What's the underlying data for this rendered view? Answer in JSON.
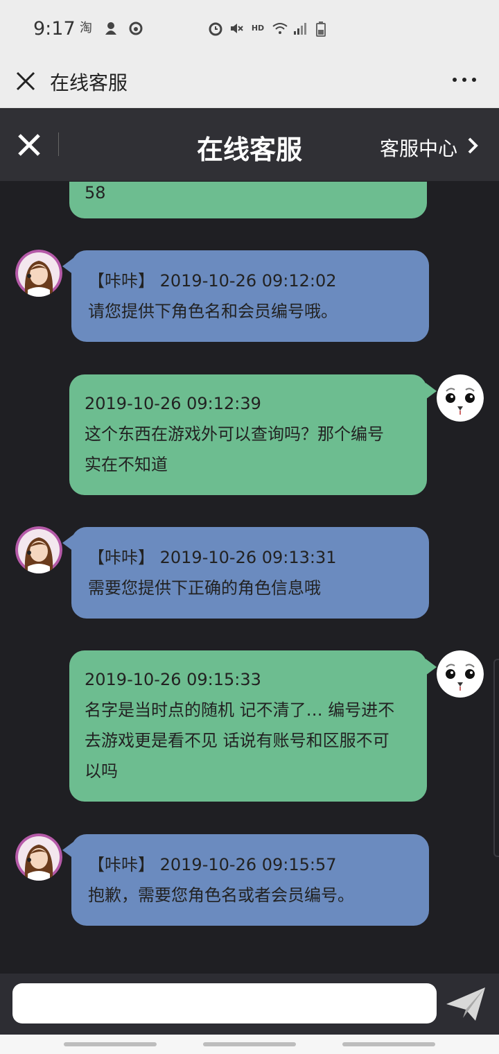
{
  "status_bar": {
    "time": "9:17",
    "left_icons": [
      "taobao-icon",
      "notification-icon",
      "netease-icon"
    ],
    "right_icons": [
      "alarm-icon",
      "mute-icon",
      "hd-icon",
      "wifi-icon",
      "signal-icon",
      "battery-icon"
    ],
    "hd_label": "HD"
  },
  "webview": {
    "title": "在线客服"
  },
  "header": {
    "title": "在线客服",
    "service_center_label": "客服中心"
  },
  "messages": [
    {
      "side": "user",
      "timestamp": "",
      "text": "58"
    },
    {
      "side": "agent",
      "timestamp": "【咔咔】 2019-10-26 09:12:02",
      "text": "请您提供下角色名和会员编号哦。"
    },
    {
      "side": "user",
      "timestamp": "2019-10-26 09:12:39",
      "text": "这个东西在游戏外可以查询吗？那个编号实在不知道",
      "lines": [
        "这个东西在游戏外可以查询吗？那个编号",
        "实在不知道"
      ]
    },
    {
      "side": "agent",
      "timestamp": "【咔咔】 2019-10-26 09:13:31",
      "text": "需要您提供下正确的角色信息哦"
    },
    {
      "side": "user",
      "timestamp": "2019-10-26 09:15:33",
      "text": "名字是当时点的随机 记不清了… 编号进不去游戏更是看不见 话说有账号和区服不可以吗",
      "lines": [
        "名字是当时点的随机 记不清了… 编号进不",
        "去游戏更是看不见 话说有账号和区服不可",
        "以吗"
      ]
    },
    {
      "side": "agent",
      "timestamp": "【咔咔】 2019-10-26 09:15:57",
      "text": "抱歉，需要您角色名或者会员编号。"
    }
  ],
  "input": {
    "value": "",
    "placeholder": ""
  },
  "colors": {
    "user_bubble": "#6dbd90",
    "agent_bubble": "#6b8bbf",
    "chat_background": "#1f1f23",
    "header_background": "#303035"
  }
}
